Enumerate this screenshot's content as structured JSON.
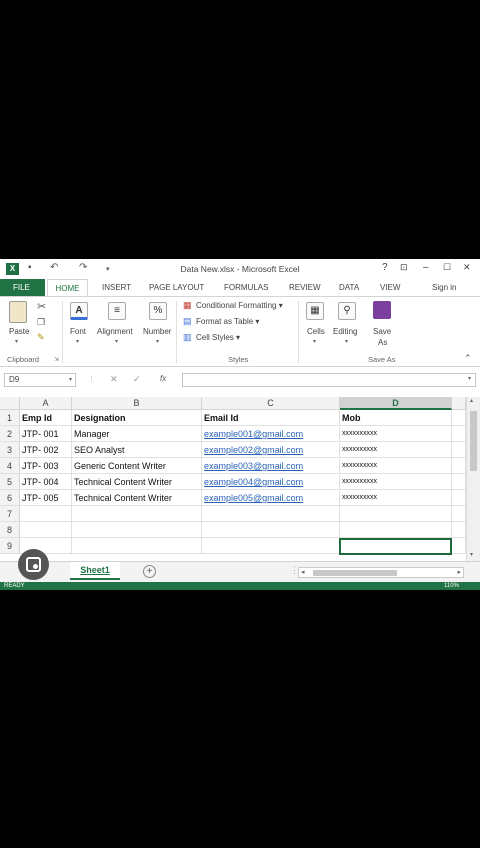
{
  "window": {
    "title": "Data New.xlsx - Microsoft Excel",
    "help": "?",
    "restore_ribbon": "⊡",
    "minimize": "–",
    "maximize": "☐",
    "close": "✕"
  },
  "quick_access": {
    "logo": "X",
    "save_icon": "save-icon",
    "undo_icon": "undo-icon",
    "redo_icon": "redo-icon"
  },
  "tabs": {
    "file": "FILE",
    "home": "HOME",
    "insert": "INSERT",
    "page_layout": "PAGE LAYOUT",
    "formulas": "FORMULAS",
    "review": "REVIEW",
    "data": "DATA",
    "view": "VIEW",
    "sign_in": "Sign in"
  },
  "ribbon": {
    "paste": "Paste",
    "clipboard": "Clipboard",
    "font": "Font",
    "alignment": "Alignment",
    "number": "Number",
    "number_glyph": "%",
    "conditional_formatting": "Conditional Formatting ▾",
    "format_as_table": "Format as Table ▾",
    "cell_styles": "Cell Styles ▾",
    "styles": "Styles",
    "cells": "Cells",
    "editing": "Editing",
    "save": "Save",
    "as": "As",
    "save_as_group": "Save As"
  },
  "formula_bar": {
    "name_box": "D9",
    "fx": "fx"
  },
  "columns": [
    "A",
    "B",
    "C",
    "D"
  ],
  "rows": [
    {
      "num": "1",
      "a": "Emp Id",
      "b": "Designation",
      "c": "Email Id",
      "d": "Mob"
    },
    {
      "num": "2",
      "a": "JTP- 001",
      "b": "Manager",
      "c": "example001@gmail.com",
      "d": "xxxxxxxxxx"
    },
    {
      "num": "3",
      "a": "JTP- 002",
      "b": "SEO Analyst",
      "c": "example002@gmail.com",
      "d": "xxxxxxxxxx"
    },
    {
      "num": "4",
      "a": "JTP- 003",
      "b": "Generic Content Writer",
      "c": "example003@gmail.com",
      "d": "xxxxxxxxxx"
    },
    {
      "num": "5",
      "a": "JTP- 004",
      "b": "Technical Content Writer",
      "c": "example004@gmail.com",
      "d": "xxxxxxxxxx"
    },
    {
      "num": "6",
      "a": "JTP- 005",
      "b": "Technical Content Writer",
      "c": "example005@gmail.com",
      "d": "xxxxxxxxxx"
    },
    {
      "num": "7",
      "a": "",
      "b": "",
      "c": "",
      "d": ""
    },
    {
      "num": "8",
      "a": "",
      "b": "",
      "c": "",
      "d": ""
    },
    {
      "num": "9",
      "a": "",
      "b": "",
      "c": "",
      "d": ""
    }
  ],
  "sheets": {
    "active": "Sheet1",
    "add": "+"
  },
  "status": {
    "ready": "READY",
    "zoom": "110%"
  },
  "colors": {
    "excel_green": "#217346",
    "link_blue": "#2b63b8"
  }
}
